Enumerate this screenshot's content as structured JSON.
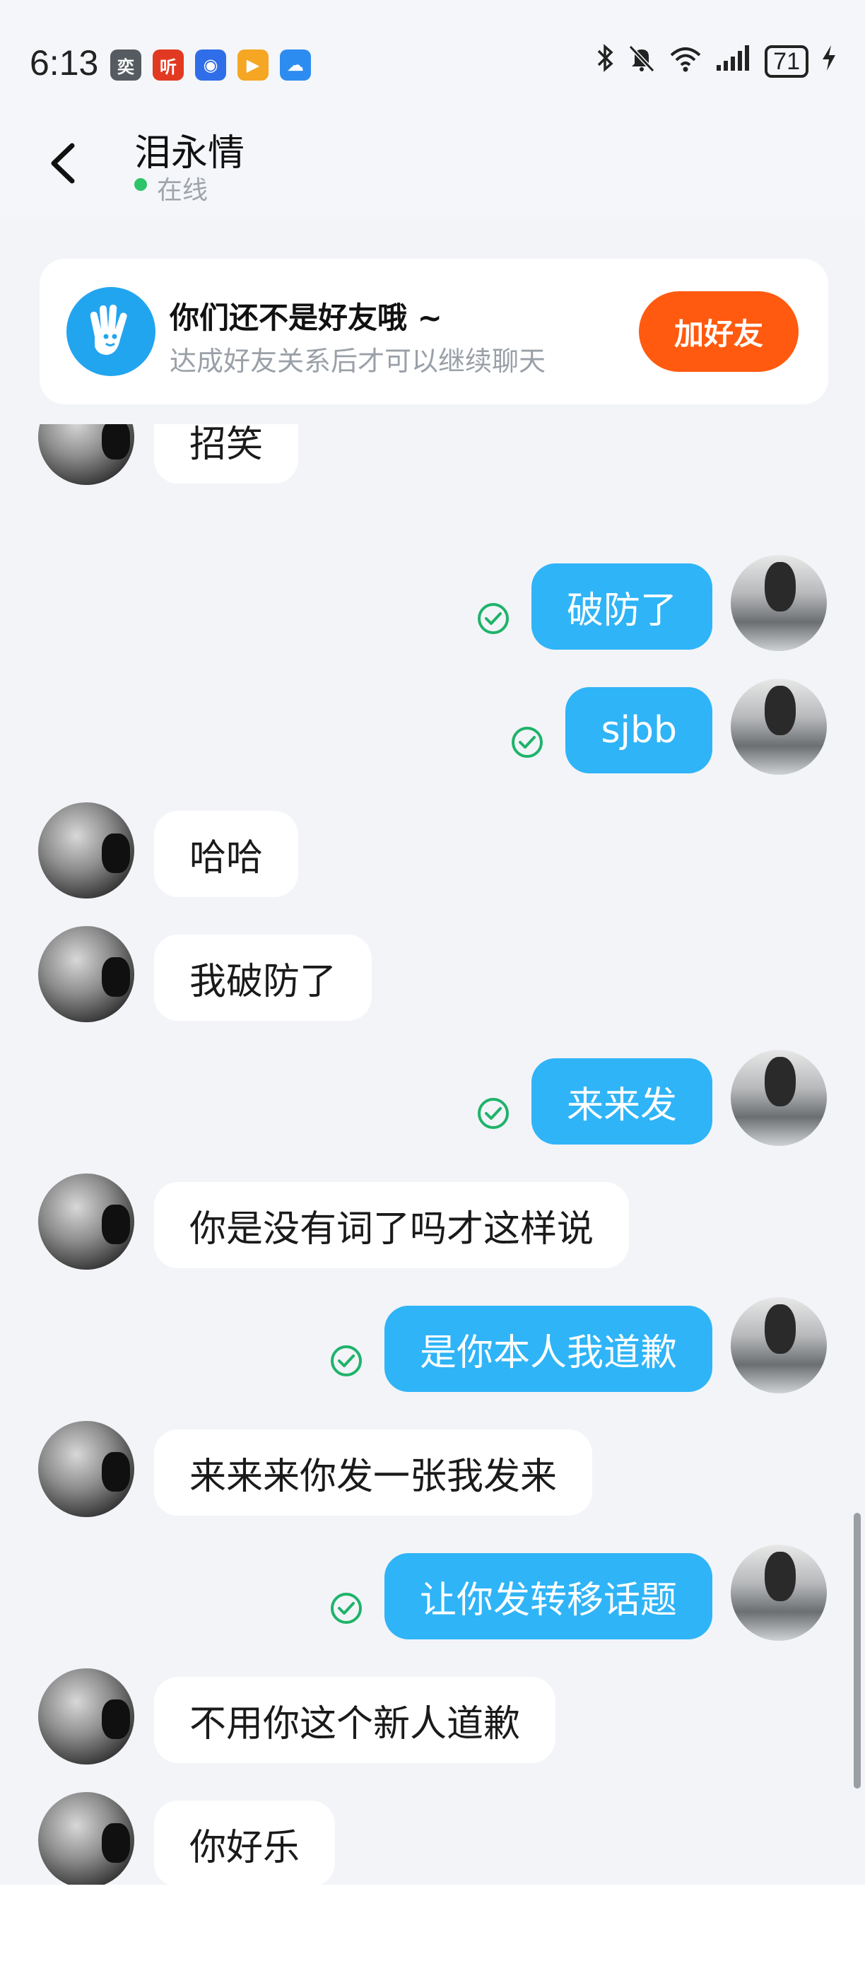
{
  "status_bar": {
    "time": "6:13",
    "apps": [
      {
        "name": "tv-app-icon",
        "glyph": "奕",
        "color": "#555b60"
      },
      {
        "name": "listen-app-icon",
        "glyph": "听",
        "color": "#e23a22"
      },
      {
        "name": "bulb-app-icon",
        "glyph": "◉",
        "color": "#2f6ee8"
      },
      {
        "name": "play-app-icon",
        "glyph": "▶",
        "color": "#f5a623"
      },
      {
        "name": "weather-app-icon",
        "glyph": "☁",
        "color": "#2d8cf0"
      }
    ],
    "battery": "71"
  },
  "header": {
    "name": "泪永情",
    "status": "在线"
  },
  "friend_card": {
    "title": "你们还不是好友哦 ~",
    "subtitle": "达成好友关系后才可以继续聊天",
    "button": "加好友"
  },
  "messages": [
    {
      "side": "left",
      "text": "招笑"
    },
    {
      "side": "right",
      "text": "破防了"
    },
    {
      "side": "right",
      "text": "sjbb"
    },
    {
      "side": "left",
      "text": "哈哈"
    },
    {
      "side": "left",
      "text": "我破防了"
    },
    {
      "side": "right",
      "text": "来来发"
    },
    {
      "side": "left",
      "text": "你是没有词了吗才这样说"
    },
    {
      "side": "right",
      "text": "是你本人我道歉"
    },
    {
      "side": "left",
      "text": "来来来你发一张我发来"
    },
    {
      "side": "right",
      "text": "让你发转移话题"
    },
    {
      "side": "left",
      "text": "不用你这个新人道歉"
    },
    {
      "side": "left",
      "text": "你好乐"
    }
  ],
  "colors": {
    "sent_bubble": "#2fb4f7",
    "received_bubble": "#ffffff",
    "add_button": "#ff5a0f",
    "online": "#2ec46a",
    "read_check": "#1fb36a"
  }
}
